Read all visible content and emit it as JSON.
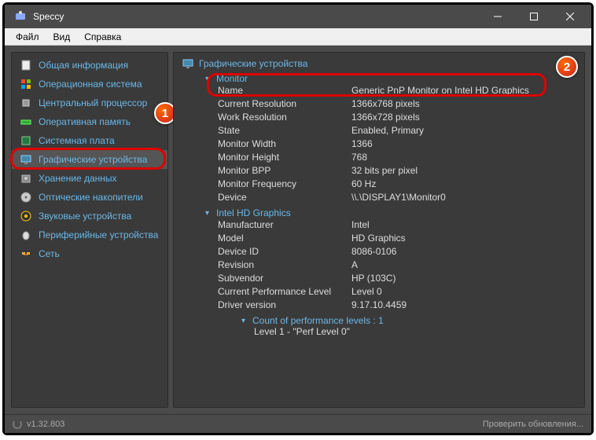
{
  "window": {
    "title": "Speccy"
  },
  "menu": {
    "file": "Файл",
    "view": "Вид",
    "help": "Справка"
  },
  "sidebar": {
    "items": [
      {
        "label": "Общая информация"
      },
      {
        "label": "Операционная система"
      },
      {
        "label": "Центральный процессор"
      },
      {
        "label": "Оперативная память"
      },
      {
        "label": "Системная плата"
      },
      {
        "label": "Графические устройства"
      },
      {
        "label": "Хранение данных"
      },
      {
        "label": "Оптические накопители"
      },
      {
        "label": "Звуковые устройства"
      },
      {
        "label": "Периферийные устройства"
      },
      {
        "label": "Сеть"
      }
    ]
  },
  "main": {
    "heading": "Графические устройства",
    "monitor": {
      "head": "Monitor",
      "name_k": "Name",
      "name_v": "Generic PnP Monitor on Intel HD Graphics",
      "cres_k": "Current Resolution",
      "cres_v": "1366x768 pixels",
      "wres_k": "Work Resolution",
      "wres_v": "1366x728 pixels",
      "state_k": "State",
      "state_v": "Enabled, Primary",
      "mw_k": "Monitor Width",
      "mw_v": "1366",
      "mh_k": "Monitor Height",
      "mh_v": "768",
      "bpp_k": "Monitor BPP",
      "bpp_v": "32 bits per pixel",
      "freq_k": "Monitor Frequency",
      "freq_v": "60 Hz",
      "dev_k": "Device",
      "dev_v": "\\\\.\\DISPLAY1\\Monitor0"
    },
    "gpu": {
      "head": "Intel HD Graphics",
      "man_k": "Manufacturer",
      "man_v": "Intel",
      "model_k": "Model",
      "model_v": "HD Graphics",
      "did_k": "Device ID",
      "did_v": "8086-0106",
      "rev_k": "Revision",
      "rev_v": "A",
      "sub_k": "Subvendor",
      "sub_v": "HP (103C)",
      "cpl_k": "Current Performance Level",
      "cpl_v": "Level 0",
      "drv_k": "Driver version",
      "drv_v": "9.17.10.4459",
      "perf_head": "Count of performance levels : 1",
      "perf_l1": "Level 1 - \"Perf Level 0\""
    }
  },
  "status": {
    "version": "v1.32.803",
    "update": "Проверить обновления..."
  },
  "badges": {
    "one": "1",
    "two": "2"
  }
}
